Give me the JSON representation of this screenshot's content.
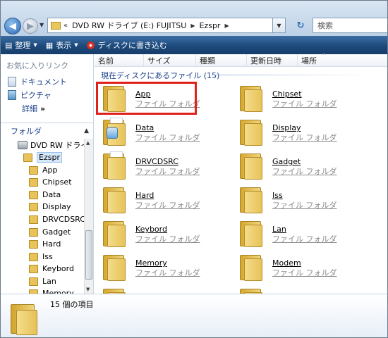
{
  "address": {
    "overflow": "«",
    "segments": [
      "DVD RW ドライブ (E:) FUJITSU",
      "Ezspr"
    ],
    "search_placeholder": "検索"
  },
  "toolbar": {
    "organize": "整理",
    "views": "表示",
    "burn": "ディスクに書き込む"
  },
  "favorites": {
    "header": "お気に入りリンク",
    "items": [
      "ドキュメント",
      "ピクチャ"
    ],
    "more": "詳細",
    "more_arrow": "»"
  },
  "folders_pane": {
    "header": "フォルダ",
    "tree": [
      {
        "label": "DVD RW ドライブ",
        "kind": "drive"
      },
      {
        "label": "Ezspr",
        "kind": "folder",
        "selected": true
      },
      {
        "label": "App",
        "kind": "folder"
      },
      {
        "label": "Chipset",
        "kind": "folder"
      },
      {
        "label": "Data",
        "kind": "folder"
      },
      {
        "label": "Display",
        "kind": "folder"
      },
      {
        "label": "DRVCDSRC",
        "kind": "folder"
      },
      {
        "label": "Gadget",
        "kind": "folder"
      },
      {
        "label": "Hard",
        "kind": "folder"
      },
      {
        "label": "Iss",
        "kind": "folder"
      },
      {
        "label": "Keybord",
        "kind": "folder"
      },
      {
        "label": "Lan",
        "kind": "folder"
      },
      {
        "label": "Memory",
        "kind": "folder"
      }
    ]
  },
  "columns": [
    "名前",
    "サイズ",
    "種類",
    "更新日時",
    "場所"
  ],
  "group_header": "現在ディスクにあるファイル (15)",
  "items": [
    {
      "name": "App",
      "type": "ファイル フォルダ"
    },
    {
      "name": "Chipset",
      "type": "ファイル フォルダ"
    },
    {
      "name": "Data",
      "type": "ファイル フォルダ"
    },
    {
      "name": "Display",
      "type": "ファイル フォルダ"
    },
    {
      "name": "DRVCDSRC",
      "type": "ファイル フォルダ"
    },
    {
      "name": "Gadget",
      "type": "ファイル フォルダ"
    },
    {
      "name": "Hard",
      "type": "ファイル フォルダ"
    },
    {
      "name": "Iss",
      "type": "ファイル フォルダ"
    },
    {
      "name": "Keybord",
      "type": "ファイル フォルダ"
    },
    {
      "name": "Lan",
      "type": "ファイル フォルダ"
    },
    {
      "name": "Memory",
      "type": "ファイル フォルダ"
    },
    {
      "name": "Modem",
      "type": "ファイル フォルダ"
    }
  ],
  "status": {
    "count": "15 個の項目"
  },
  "colors": {
    "highlight": "#e0211b",
    "link": "#1a3f8a",
    "toolbar": "#1d4a7d"
  }
}
